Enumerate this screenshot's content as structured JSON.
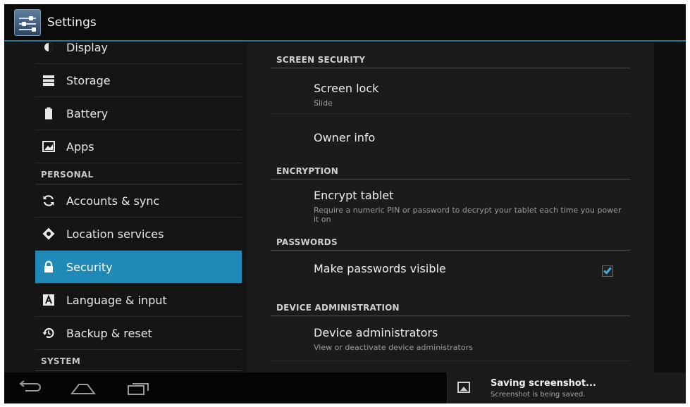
{
  "actionbar": {
    "title": "Settings",
    "icon": "settings-sliders-icon"
  },
  "sidebar": {
    "items": [
      {
        "type": "item",
        "label": "Display",
        "icon": "display-icon"
      },
      {
        "type": "item",
        "label": "Storage",
        "icon": "storage-icon"
      },
      {
        "type": "item",
        "label": "Battery",
        "icon": "battery-icon"
      },
      {
        "type": "item",
        "label": "Apps",
        "icon": "apps-icon"
      },
      {
        "type": "header",
        "label": "PERSONAL"
      },
      {
        "type": "item",
        "label": "Accounts & sync",
        "icon": "sync-icon"
      },
      {
        "type": "item",
        "label": "Location services",
        "icon": "location-icon"
      },
      {
        "type": "item",
        "label": "Security",
        "icon": "lock-icon",
        "active": true
      },
      {
        "type": "item",
        "label": "Language & input",
        "icon": "language-icon"
      },
      {
        "type": "item",
        "label": "Backup & reset",
        "icon": "backup-icon"
      },
      {
        "type": "header",
        "label": "SYSTEM"
      }
    ]
  },
  "main": {
    "sections": {
      "screen_security": "SCREEN SECURITY",
      "encryption": "ENCRYPTION",
      "passwords": "PASSWORDS",
      "device_admin": "DEVICE ADMINISTRATION"
    },
    "screen_lock": {
      "title": "Screen lock",
      "summary": "Slide"
    },
    "owner_info": {
      "title": "Owner info"
    },
    "encrypt_tablet": {
      "title": "Encrypt tablet",
      "summary": "Require a numeric PIN or password to decrypt your tablet each time you power it on"
    },
    "make_passwords_visible": {
      "title": "Make passwords visible",
      "checked": true
    },
    "device_administrators": {
      "title": "Device administrators",
      "summary": "View or deactivate device administrators"
    }
  },
  "navbar": {
    "buttons": [
      "back-icon",
      "home-icon",
      "recent-apps-icon"
    ],
    "toast": {
      "title": "Saving screenshot...",
      "subtitle": "Screenshot is being saved.",
      "icon": "image-icon"
    }
  },
  "colors": {
    "accent": "#33b5e5",
    "selected": "#1f8ab8",
    "background": "#1b1b1b"
  }
}
